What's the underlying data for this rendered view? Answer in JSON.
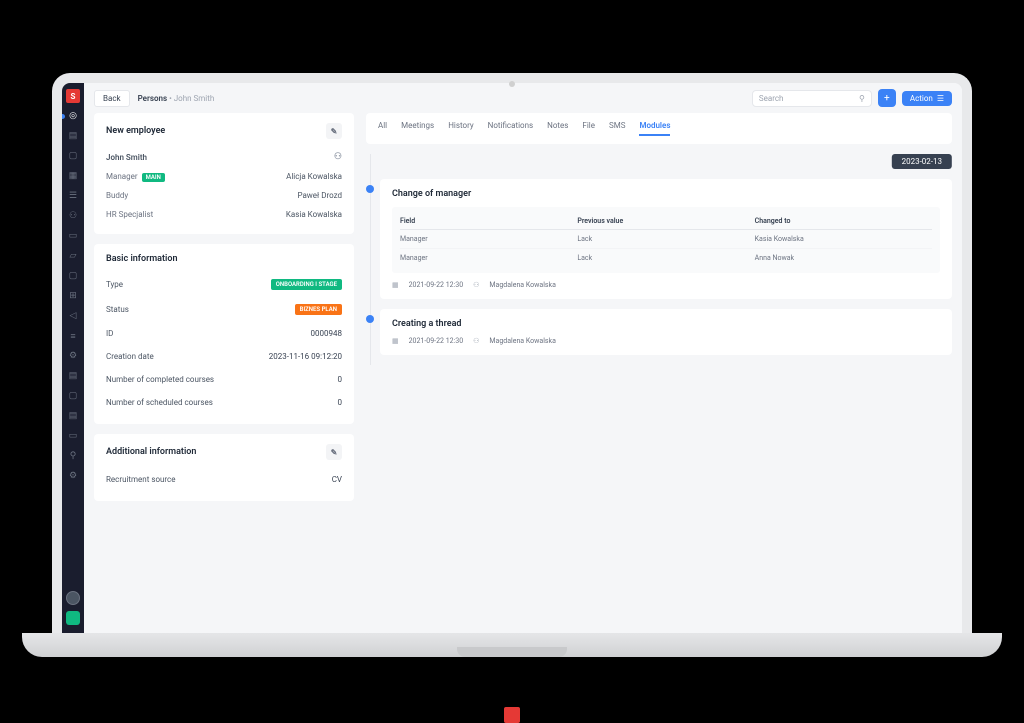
{
  "topbar": {
    "back": "Back",
    "breadcrumb_main": "Persons",
    "breadcrumb_sub": "John Smith",
    "search_placeholder": "Search",
    "action": "Action"
  },
  "employee_card": {
    "title": "New employee",
    "name": "John Smith",
    "rows": [
      {
        "label": "Manager",
        "badge": "MAIN",
        "value": "Alicja Kowalska"
      },
      {
        "label": "Buddy",
        "badge": "",
        "value": "Paweł Drozd"
      },
      {
        "label": "HR Specjalist",
        "badge": "",
        "value": "Kasia Kowalska"
      }
    ]
  },
  "basic_info": {
    "title": "Basic information",
    "type_label": "Type",
    "type_tag": "ONBOARDING I STAGE",
    "status_label": "Status",
    "status_tag": "BIZNES PLAN",
    "id_label": "ID",
    "id_value": "0000948",
    "date_label": "Creation date",
    "date_value": "2023-11-16 09:12:20",
    "completed_label": "Number of completed courses",
    "completed_value": "0",
    "scheduled_label": "Number of scheduled courses",
    "scheduled_value": "0"
  },
  "additional_info": {
    "title": "Additional information",
    "source_label": "Recruitment source",
    "source_value": "CV"
  },
  "tabs": {
    "all": "All",
    "meetings": "Meetings",
    "history": "History",
    "notifications": "Notifications",
    "notes": "Notes",
    "file": "File",
    "sms": "SMS",
    "modules": "Modules"
  },
  "timeline": {
    "date": "2023-02-13",
    "item1": {
      "title": "Change of manager",
      "th_field": "Field",
      "th_prev": "Previous value",
      "th_changed": "Changed to",
      "rows": [
        {
          "field": "Manager",
          "prev": "Lack",
          "changed": "Kasia Kowalska"
        },
        {
          "field": "Manager",
          "prev": "Lack",
          "changed": "Anna Nowak"
        }
      ],
      "meta_date": "2021-09-22  12:30",
      "meta_user": "Magdalena Kowalska"
    },
    "item2": {
      "title": "Creating a thread",
      "meta_date": "2021-09-22  12:30",
      "meta_user": "Magdalena Kowalska"
    }
  }
}
